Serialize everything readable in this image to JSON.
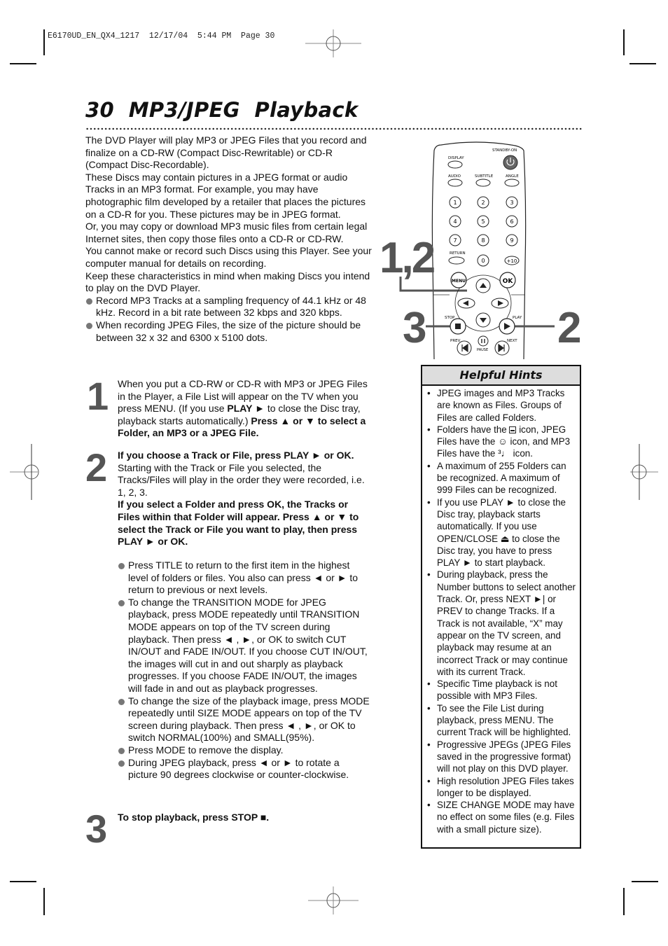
{
  "slug": {
    "text": "E6170UD_EN_QX4_1217  12/17/04  5:44 PM  Page 30"
  },
  "header": {
    "page_number": "30",
    "title": "MP3/JPEG  Playback"
  },
  "intro": {
    "paragraphs": [
      "The DVD Player will play MP3 or JPEG Files that you record and finalize on a CD-RW (Compact Disc-Rewritable) or CD-R (Compact Disc-Recordable).",
      "These Discs may contain pictures in a JPEG format or audio Tracks in an MP3 format. For example, you may have photographic film developed by a retailer that places the pictures on a CD-R for you.  These pictures may be in JPEG format.",
      "Or, you may copy or download MP3 music files from certain legal Internet sites, then copy those files onto a CD-R or CD-RW.",
      "You cannot make or record such Discs using this Player. See your computer manual for details on recording.",
      "Keep these characteristics in mind when making Discs you intend to play on the DVD Player."
    ],
    "bullets": [
      "Record MP3 Tracks at a sampling frequency of 44.1 kHz or 48 kHz. Record in a bit rate between 32 kbps and 320 kbps.",
      "When recording JPEG Files, the size of the picture should be between 32 x 32 and 6300 x 5100 dots."
    ]
  },
  "steps": [
    {
      "number": "1",
      "text_a": "When you put a CD-RW or CD-R with MP3 or JPEG Files in the Player, a File List will appear on the TV when you press MENU. (If you use ",
      "bold_a": "PLAY ►",
      "text_b": " to close the Disc tray, playback starts automatically.) ",
      "bold_b": "Press ▲ or ▼ to select a Folder, an MP3 or a JPEG File."
    },
    {
      "number": "2",
      "bold_a": "If you choose a Track or File, press PLAY ► or OK.",
      "text_a": " Starting with the Track or File you selected, the Tracks/Files will play in the order they were recorded, i.e. 1, 2, 3.",
      "bold_b": "If you select a Folder and press OK, the Tracks or Files within that Folder will appear. Press ▲ or ▼ to select the Track or File you want to play, then press PLAY ►  or OK."
    },
    {
      "number": "3",
      "bold_a": "To stop playback, press STOP ■."
    }
  ],
  "step2_bullets": [
    "Press TITLE to return to the first item in the highest level of folders or files. You also can press ◄ or ► to return to previous or next levels.",
    "To change the TRANSITION MODE for JPEG playback, press MODE repeatedly until TRANSITION MODE appears on top of the TV screen during playback.  Then press ◄ , ►, or OK to switch CUT IN/OUT and FADE IN/OUT.  If you choose CUT IN/OUT, the images will cut in and out sharply as playback progresses.  If you choose FADE IN/OUT, the images will fade in and out as playback progresses.",
    "To change the size of the playback image, press MODE repeatedly until SIZE MODE appears on top of the TV screen during playback.  Then press ◄ , ►, or OK to switch NORMAL(100%) and SMALL(95%).",
    "Press MODE to remove the display.",
    "During JPEG playback, press ◄ or ► to rotate a picture 90 degrees clockwise or counter-clockwise."
  ],
  "remote": {
    "labels": {
      "display": "DISPLAY",
      "standby": "STANDBY-ON",
      "audio": "AUDIO",
      "subtitle": "SUBTITLE",
      "angle": "ANGLE",
      "return": "RETURN",
      "menu": "MENU",
      "ok": "OK",
      "stop": "STOP",
      "play": "PLAY",
      "prev": "PREV",
      "pause": "PAUSE",
      "next": "NEXT",
      "plus10": "+10"
    },
    "digits": [
      "1",
      "2",
      "3",
      "4",
      "5",
      "6",
      "7",
      "8",
      "9",
      "0"
    ],
    "callouts": {
      "left_top": "1,2",
      "left_bottom": "3",
      "right": "2"
    }
  },
  "hints": {
    "title": "Helpful Hints",
    "items": [
      {
        "text": "JPEG images and MP3 Tracks are known as Files. Groups of Files are called Folders."
      },
      {
        "pre": "Folders have the ",
        "mid1": " icon, JPEG Files have the ",
        "smile": "☺",
        "mid2": " icon, and MP3 Files have the ",
        "note": "³♩",
        "post": " icon."
      },
      {
        "text": "A maximum of 255 Folders can be recognized.  A maximum of 999 Files can be recognized."
      },
      {
        "text": "If you use PLAY ► to close the Disc tray, playback starts automatically. If you use OPEN/CLOSE ⏏ to close the Disc tray, you have to press PLAY ► to start playback."
      },
      {
        "text": "During playback, press the Number buttons to select another Track. Or, press NEXT ►| or PREV to change Tracks. If a Track is not available, “X” may appear on the TV screen, and playback may resume at an incorrect Track or may continue with its current Track."
      },
      {
        "text": "Specific Time playback is not possible with MP3 Files."
      },
      {
        "text": "To see the File List during playback, press MENU. The current Track will be highlighted."
      },
      {
        "text": "Progressive JPEGs (JPEG Files saved in the progressive format) will not play on this DVD player."
      },
      {
        "text": "High resolution JPEG Files takes longer to be displayed."
      },
      {
        "text": "SIZE CHANGE MODE may have no effect on some files (e.g. Files with a small picture size)."
      }
    ]
  }
}
